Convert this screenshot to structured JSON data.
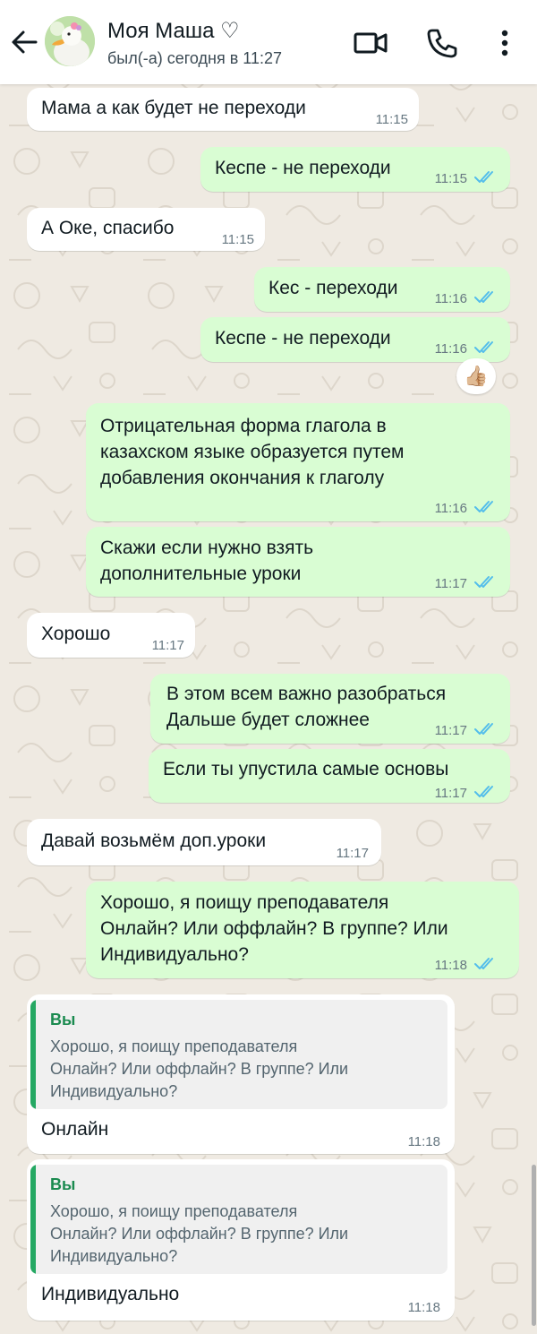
{
  "header": {
    "contact_name": "Моя Маша ♡",
    "status": "был(-а) сегодня в 11:27",
    "icons": [
      "back-arrow-icon",
      "video-call-icon",
      "phone-call-icon",
      "more-options-icon"
    ]
  },
  "messages": [
    {
      "direction": "in",
      "text": "Мама а как будет не переходи",
      "time": "11:15"
    },
    {
      "direction": "out",
      "text": "Кеспе - не переходи",
      "time": "11:15",
      "status": "read"
    },
    {
      "direction": "in",
      "text": "А Оке, спасибо",
      "time": "11:15"
    },
    {
      "direction": "out",
      "text": "Кес - переходи",
      "time": "11:16",
      "status": "read"
    },
    {
      "direction": "out",
      "text": "Кеспе - не переходи",
      "time": "11:16",
      "status": "read",
      "reaction": "👍🏼"
    },
    {
      "direction": "out",
      "text": "Отрицательная форма глагола в\nказахском языке образуется путем\nдобавления окончания к глаголу",
      "time": "11:16",
      "status": "read"
    },
    {
      "direction": "out",
      "text": "Скажи если нужно взять\nдополнительные уроки",
      "time": "11:17",
      "status": "read"
    },
    {
      "direction": "in",
      "text": "Хорошо",
      "time": "11:17"
    },
    {
      "direction": "out",
      "text": "В этом всем важно разобраться\nДальше будет сложнее",
      "time": "11:17",
      "status": "read"
    },
    {
      "direction": "out",
      "text": "Если ты упустила самые основы",
      "time": "11:17",
      "status": "read"
    },
    {
      "direction": "in",
      "text": "Давай возьмём доп.уроки",
      "time": "11:17"
    },
    {
      "direction": "out",
      "text": "Хорошо, я поищу преподавателя\nОнлайн? Или оффлайн? В группе? Или\nИндивидуально?",
      "time": "11:18",
      "status": "read"
    },
    {
      "direction": "in",
      "text": "Онлайн",
      "time": "11:18",
      "quote": {
        "author": "Вы",
        "text": "Хорошо, я поищу преподавателя\nОнлайн? Или оффлайн? В группе? Или\nИндивидуально?"
      }
    },
    {
      "direction": "in",
      "text": "Индивидуально",
      "time": "11:18",
      "quote": {
        "author": "Вы",
        "text": "Хорошо, я поищу преподавателя\nОнлайн? Или оффлайн? В группе? Или\nИндивидуально?"
      }
    }
  ],
  "colors": {
    "background": "#efeae2",
    "incoming_bubble": "#ffffff",
    "outgoing_bubble": "#d9fdd3",
    "read_ticks": "#53bdeb",
    "quote_accent": "#25a863"
  }
}
